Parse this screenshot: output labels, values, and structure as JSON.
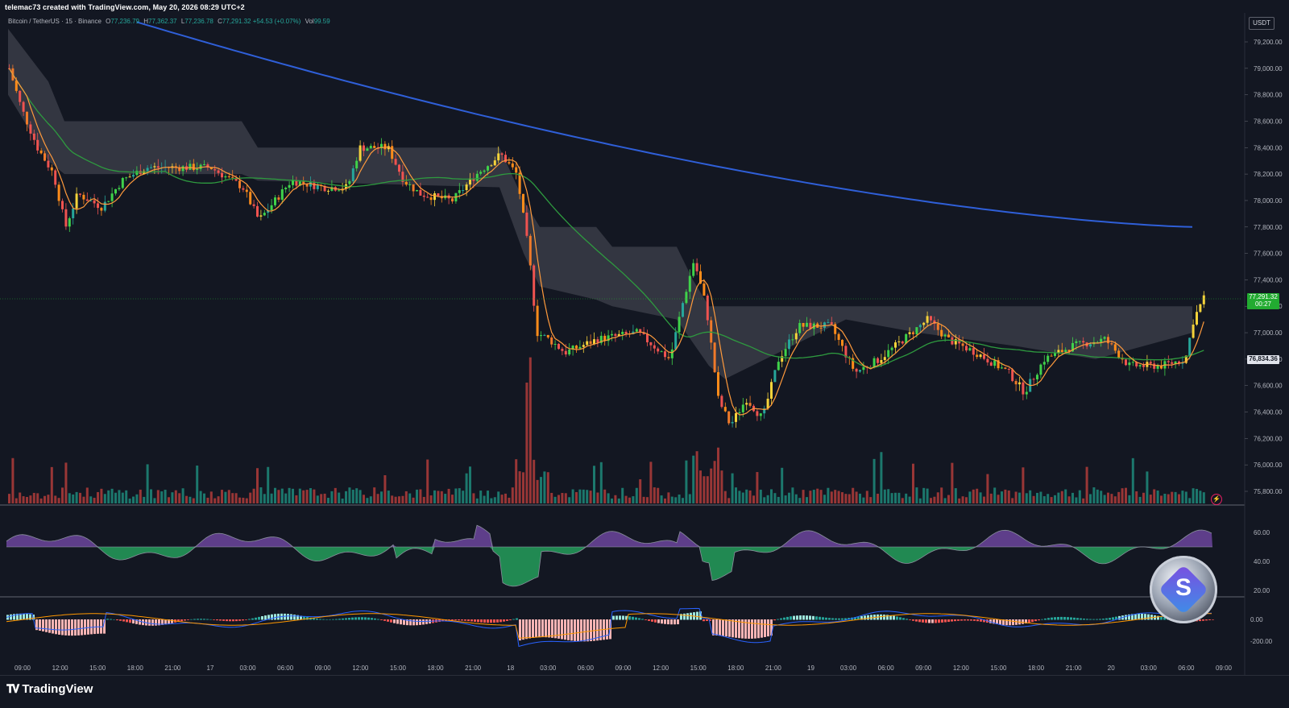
{
  "header": {
    "credit": "telemac73 created with TradingView.com, May 20, 2026 08:29 UTC+2"
  },
  "legend": {
    "symbol": "Bitcoin / TetherUS · 15 · Binance",
    "o_label": "O",
    "o": "77,236.79",
    "h_label": "H",
    "h": "77,362.37",
    "l_label": "L",
    "l": "77,236.78",
    "c_label": "C",
    "c": "77,291.32",
    "change": "+54.53 (+0.07%)",
    "vol_label": "Vol",
    "vol": "99.59"
  },
  "price_axis": {
    "currency": "USDT",
    "current_price": "77,291.32",
    "countdown": "00:27",
    "marked_price": "76,834.36",
    "labels": [
      "79,200.00",
      "79,000.00",
      "78,800.00",
      "78,600.00",
      "78,400.00",
      "78,200.00",
      "78,000.00",
      "77,800.00",
      "77,600.00",
      "77,400.00",
      "77,200.00",
      "77,000.00",
      "76,800.00",
      "76,600.00",
      "76,400.00",
      "76,200.00",
      "76,000.00",
      "75,800.00"
    ]
  },
  "rsi_axis": {
    "labels": [
      "60.00",
      "40.00",
      "20.00"
    ]
  },
  "macd_axis": {
    "labels": [
      "0.00",
      "-200.00"
    ]
  },
  "time_axis": {
    "labels": [
      "09:00",
      "12:00",
      "15:00",
      "18:00",
      "21:00",
      "17",
      "03:00",
      "06:00",
      "09:00",
      "12:00",
      "15:00",
      "18:00",
      "21:00",
      "18",
      "03:00",
      "06:00",
      "09:00",
      "12:00",
      "15:00",
      "18:00",
      "21:00",
      "19",
      "03:00",
      "06:00",
      "09:00",
      "12:00",
      "15:00",
      "18:00",
      "21:00",
      "20",
      "03:00",
      "06:00",
      "09:00"
    ]
  },
  "footer": {
    "brand": "TradingView"
  },
  "colors": {
    "background": "#131722",
    "up_green": "#26a69a",
    "bright_green": "#3fd24a",
    "down_red": "#ef5350",
    "orange": "#ff8c1a",
    "yellow": "#f5d33a",
    "blue_ma": "#2f5fd8",
    "green_ma": "#2e9a3f",
    "orange_ma": "#ff9a3c",
    "cloud": "#3a3c47",
    "rsi_purple": "#9c5fe0",
    "rsi_green": "#2ee87a",
    "macd_blue": "#2962ff",
    "macd_orange": "#ff9800"
  },
  "icons": {
    "lightning": "lightning-icon",
    "logo": "tradingview-logo-icon",
    "badge": "coin-badge-icon"
  }
}
